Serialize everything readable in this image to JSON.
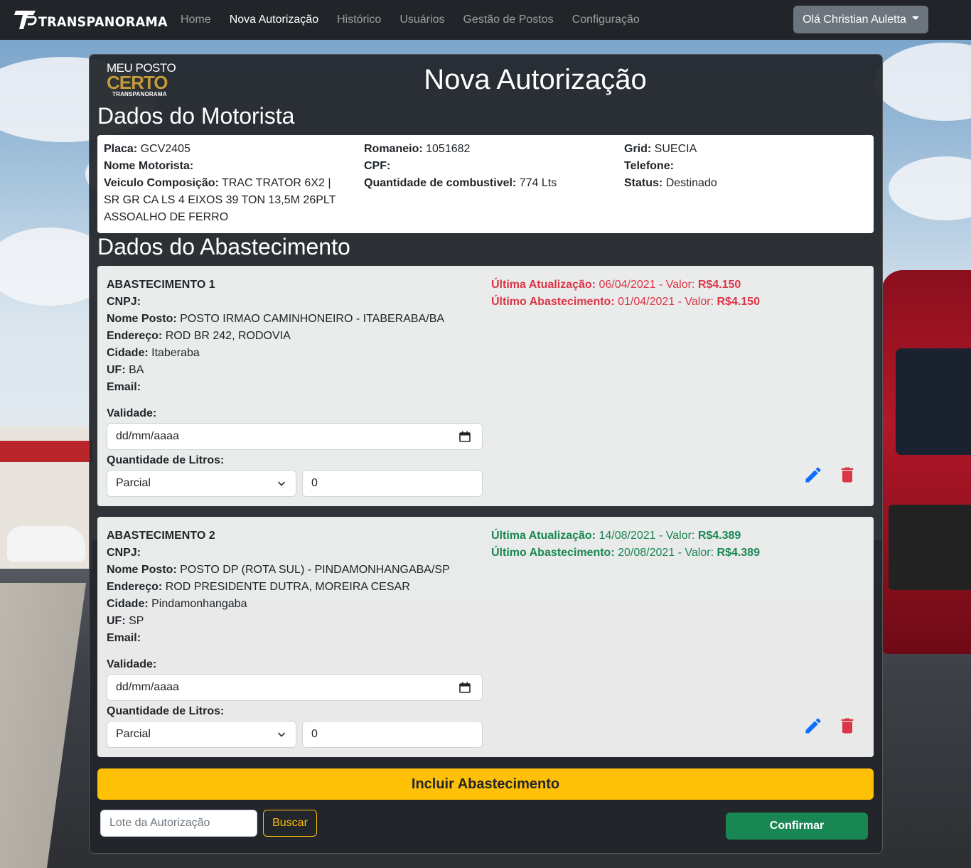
{
  "nav": {
    "brand": "TRANSPANORAMA",
    "links": [
      "Home",
      "Nova Autorização",
      "Histórico",
      "Usuários",
      "Gestão de Postos",
      "Configuração"
    ],
    "user_label": "Olá Christian Auletta"
  },
  "logo": {
    "line1": "MEU POSTO",
    "line2": "CERTO",
    "line3": "TRANSPANORAMA"
  },
  "page_title": "Nova Autorização",
  "motorista": {
    "section_title": "Dados do Motorista",
    "placa_label": "Placa:",
    "placa": "GCV2405",
    "nome_label": "Nome Motorista:",
    "nome": "",
    "veiculo_label": "Veiculo Composição:",
    "veiculo": "TRAC TRATOR 6X2 | SR GR CA LS 4 EIXOS 39 TON 13,5M 26PLT ASSOALHO DE FERRO",
    "romaneio_label": "Romaneio:",
    "romaneio": "1051682",
    "cpf_label": "CPF:",
    "cpf": "",
    "combustivel_label": "Quantidade de combustivel:",
    "combustivel": "774 Lts",
    "grid_label": "Grid:",
    "grid": "SUECIA",
    "telefone_label": "Telefone:",
    "telefone": "",
    "status_label": "Status:",
    "status": "Destinado"
  },
  "abastecimento": {
    "section_title": "Dados do Abastecimento",
    "labels": {
      "cnpj": "CNPJ:",
      "posto": "Nome Posto:",
      "endereco": "Endereço:",
      "cidade": "Cidade:",
      "uf": "UF:",
      "email": "Email:",
      "validade": "Validade:",
      "litros": "Quantidade de Litros:",
      "ultima_atualizacao": "Última Atualização:",
      "ultimo_abastecimento": "Último Abastecimento:",
      "valor": "- Valor:"
    },
    "items": [
      {
        "title": "ABASTECIMENTO 1",
        "cnpj": "",
        "posto": "POSTO IRMAO CAMINHONEIRO - ITABERABA/BA",
        "endereco": "ROD BR 242, RODOVIA",
        "cidade": "Itaberaba",
        "uf": "BA",
        "email": "",
        "validade_placeholder": "dd/mm/aaaa",
        "tipo_litros": "Parcial",
        "litros": "0",
        "ultima_atualizacao_data": "06/04/2021",
        "ultima_atualizacao_valor": "R$4.150",
        "ultimo_abastecimento_data": "01/04/2021",
        "ultimo_abastecimento_valor": "R$4.150",
        "status_color": "#dc3545"
      },
      {
        "title": "ABASTECIMENTO 2",
        "cnpj": "",
        "posto": "POSTO DP (ROTA SUL) - PINDAMONHANGABA/SP",
        "endereco": "ROD PRESIDENTE DUTRA, MOREIRA CESAR",
        "cidade": "Pindamonhangaba",
        "uf": "SP",
        "email": "",
        "validade_placeholder": "dd/mm/aaaa",
        "tipo_litros": "Parcial",
        "litros": "0",
        "ultima_atualizacao_data": "14/08/2021",
        "ultima_atualizacao_valor": "R$4.389",
        "ultimo_abastecimento_data": "20/08/2021",
        "ultimo_abastecimento_valor": "R$4.389",
        "status_color": "#198754"
      }
    ]
  },
  "actions": {
    "incluir": "Incluir Abastecimento",
    "lote_placeholder": "Lote da Autorização",
    "buscar": "Buscar",
    "confirmar": "Confirmar"
  },
  "colors": {
    "navbar": "#212529",
    "warning": "#ffc107",
    "success": "#198754",
    "danger": "#dc3545",
    "primary": "#0d6efd"
  },
  "icons": [
    "brand-logo-icon",
    "calendar-icon",
    "chevron-down-icon",
    "pencil-icon",
    "trash-icon"
  ]
}
